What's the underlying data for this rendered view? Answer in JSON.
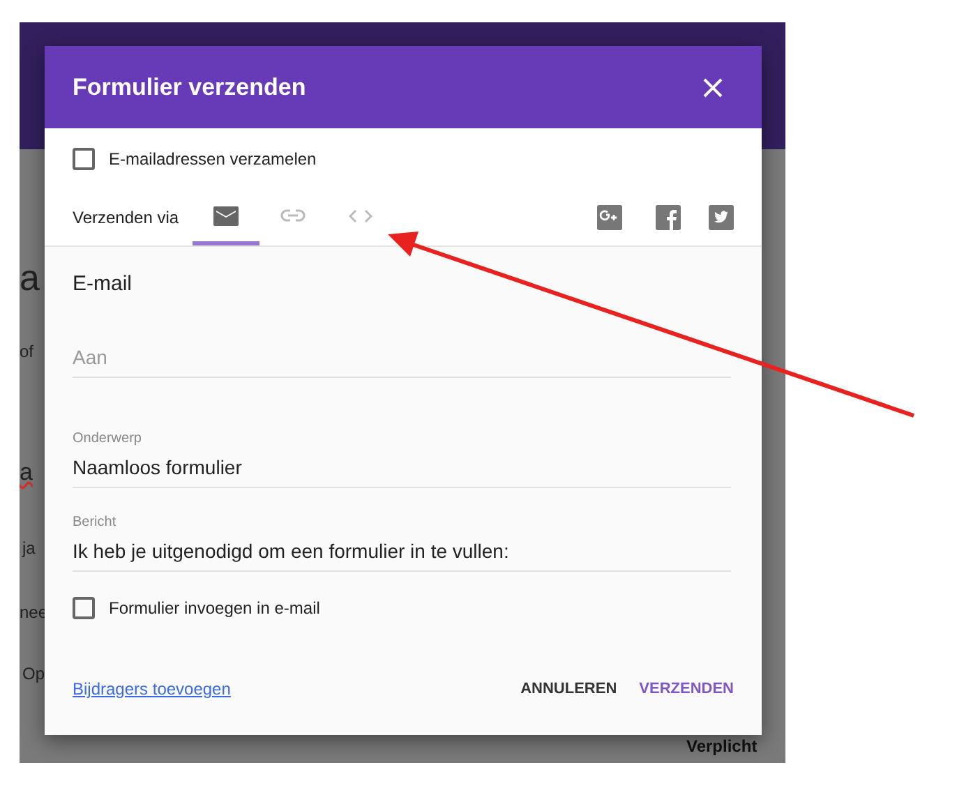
{
  "background": {
    "texts": [
      "a",
      "of",
      "a",
      "ja",
      "nee",
      "Op"
    ],
    "footer_label": "Verplicht"
  },
  "dialog": {
    "title": "Formulier verzenden",
    "collect_emails": {
      "label": "E-mailadressen verzamelen",
      "checked": false
    },
    "send_via": {
      "label": "Verzenden via",
      "tabs": [
        {
          "kind": "email",
          "selected": true
        },
        {
          "kind": "link",
          "selected": false
        },
        {
          "kind": "embed",
          "selected": false
        }
      ],
      "share": [
        {
          "kind": "gplus"
        },
        {
          "kind": "facebook"
        },
        {
          "kind": "twitter"
        }
      ]
    },
    "section_title": "E-mail",
    "to": {
      "placeholder": "Aan"
    },
    "subject": {
      "label": "Onderwerp",
      "value": "Naamloos formulier"
    },
    "message": {
      "label": "Bericht",
      "value": "Ik heb je uitgenodigd om een formulier in te vullen:"
    },
    "include_form": {
      "label": "Formulier invoegen in e-mail",
      "checked": false
    },
    "add_collaborators": "Bijdragers toevoegen",
    "buttons": [
      {
        "label": "ANNULEREN",
        "kind": "cancel"
      },
      {
        "label": "VERZENDEN",
        "kind": "primary"
      }
    ]
  }
}
